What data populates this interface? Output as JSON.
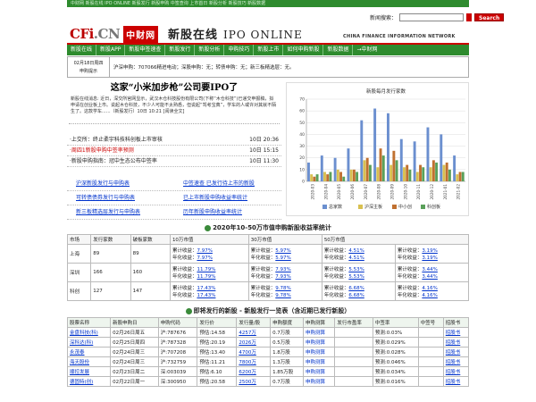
{
  "top_strip": "中财网 新股在线 IPO ONLINE 新股发行 新股申购 中签查询 上市首日 新股分析 新股技巧 新股数据",
  "search": {
    "label": "新闻搜索：",
    "placeholder": "",
    "button": "Search"
  },
  "logo": {
    "cfi": "CFi",
    "cn": ".CN",
    "zcw": "中财网"
  },
  "banner": {
    "title": "新股在线",
    "ipo": "IPO ONLINE",
    "en": "CHINA FINANCE INFORMATION NETWORK"
  },
  "nav": [
    "新股在线",
    "新股APP",
    "新股申签速查",
    "新股发行",
    "新股分析",
    "申购技巧",
    "新股上市",
    "如何申购新股",
    "新股数据",
    "→中财网"
  ],
  "notice": {
    "date": "02月18日周四",
    "label": "申购提示",
    "text_html": "沪深申购：707066精进电动；深股申购：无；转债申购：无；新三板精选层：无。"
  },
  "news": {
    "headline": "这家“小米加步枪”公司要IPO了",
    "para": "新股在线消息: 近日，深交所官网显示，武汉木仓科技股份有限公司(下称“木仓科技”)已递交申报稿，拟申请在创业板上市。说起木仓科技，不少人可能不太熟悉，但说起“驾考宝典”，学车的人或许对其就不陌生了。这款学车......（新股发行）10日 10:21 [阅读全文]",
    "items": [
      {
        "title": "·上交所：终止柔宇科技科创板上市审核",
        "time": "10日 20:36",
        "hl": false
      },
      {
        "title": "·周四1新股申购中签率预测",
        "time": "10日 15:15",
        "hl": true
      },
      {
        "title": "·新股申购指南：冠中生态公布中签率",
        "time": "10日 11:30",
        "hl": false
      }
    ]
  },
  "links": [
    [
      "沪深新股发行与申购表",
      "中签速查 已发行待上市的新股"
    ],
    [
      "可转债债券发行与申购表",
      "已上市新股申购收益率统计"
    ],
    [
      "新三板精选层发行与申购表",
      "历年新股申购收益率统计"
    ]
  ],
  "chart_data": {
    "type": "bar",
    "title": "新股每月发行家数",
    "categories": [
      "2020-03",
      "2020-04",
      "2020-05",
      "2020-06",
      "2020-07",
      "2020-08",
      "2020-09",
      "2020-10",
      "2020-11",
      "2020-12",
      "2021-01",
      "2021-02"
    ],
    "series": [
      {
        "name": "总家数",
        "color": "#6b8fcf",
        "values": [
          16,
          22,
          20,
          28,
          52,
          62,
          58,
          36,
          34,
          46,
          40,
          22
        ]
      },
      {
        "name": "沪深主板",
        "color": "#d8c050",
        "values": [
          6,
          8,
          10,
          10,
          18,
          12,
          14,
          12,
          8,
          12,
          14,
          6
        ]
      },
      {
        "name": "中小创",
        "color": "#c07030",
        "values": [
          4,
          6,
          8,
          10,
          20,
          28,
          26,
          14,
          14,
          18,
          16,
          8
        ]
      },
      {
        "name": "科创板",
        "color": "#5aa05a",
        "values": [
          6,
          8,
          4,
          8,
          14,
          22,
          18,
          10,
          12,
          16,
          10,
          8
        ]
      }
    ],
    "ylim": [
      0,
      70
    ],
    "yticks": [
      0,
      10,
      20,
      30,
      40,
      50,
      60,
      70
    ],
    "legend": "bottom"
  },
  "rate": {
    "title": "2020年10-50万市值申购新股收益率统计",
    "headers": [
      "市场",
      "发行家数",
      "破板家数",
      "10万市值",
      "30万市值",
      "50万市值"
    ],
    "rows": [
      {
        "market": "上海",
        "issued": "89",
        "broken": "89",
        "c10": [
          "累计收益：",
          "7.97%",
          "年化收益：",
          "7.97%"
        ],
        "c30": [
          "累计收益：",
          "5.97%",
          "年化收益：",
          "5.97%"
        ],
        "c50": [
          "累计收益：",
          "4.51%",
          "年化收益：",
          "4.51%"
        ],
        "c50b": [
          "累计收益：",
          "3.19%",
          "年化收益：",
          "3.19%"
        ]
      },
      {
        "market": "深圳",
        "issued": "166",
        "broken": "160",
        "c10": [
          "累计收益：",
          "11.79%",
          "年化收益：",
          "11.79%"
        ],
        "c30": [
          "累计收益：",
          "7.93%",
          "年化收益：",
          "7.93%"
        ],
        "c50": [
          "累计收益：",
          "5.53%",
          "年化收益：",
          "5.53%"
        ],
        "c50b": [
          "累计收益：",
          "3.44%",
          "年化收益：",
          "3.44%"
        ]
      },
      {
        "market": "科创",
        "issued": "127",
        "broken": "147",
        "c10": [
          "累计收益：",
          "17.43%",
          "年化收益：",
          "17.43%"
        ],
        "c30": [
          "累计收益：",
          "9.78%",
          "年化收益：",
          "9.78%"
        ],
        "c50": [
          "累计收益：",
          "6.68%",
          "年化收益：",
          "6.68%"
        ],
        "c50b": [
          "累计收益：",
          "4.16%",
          "年化收益：",
          "4.16%"
        ]
      }
    ]
  },
  "upcoming": {
    "title": "即将发行的新股 - 新股发行一览表（含近期已发行新股）",
    "headers": [
      "股票名称",
      "新股申购日",
      "申购代码",
      "发行价",
      "发行量/股",
      "申购额度",
      "申购测算",
      "发行市盈率",
      "中签率",
      "中签号",
      "招股书"
    ],
    "rows": [
      [
        "金盘科技(科)",
        "02月26日周五",
        "沪:787676",
        "预估:14.58",
        "4257万",
        "0.7万股",
        "申购测算",
        "",
        "预测:0.03%",
        "",
        "招股书"
      ],
      [
        "深科达(科)",
        "02月25日周四",
        "沪:787328",
        "预估:20.19",
        "2026万",
        "0.5万股",
        "申购测算",
        "",
        "预测:0.029%",
        "",
        "招股书"
      ],
      [
        "永茂泰",
        "02月24日周三",
        "沪:707208",
        "预估:13.40",
        "4700万",
        "1.8万股",
        "申购测算",
        "",
        "预测:0.028%",
        "",
        "招股书"
      ],
      [
        "海天股份",
        "02月24日周三",
        "沪:732759",
        "预估:11.21",
        "7800万",
        "1.3万股",
        "申购测算",
        "",
        "预测:0.046%",
        "",
        "招股书"
      ],
      [
        "顺控发展",
        "02月23日周二",
        "深:003039",
        "预估:6.10",
        "6200万",
        "1.85万股",
        "申购测算",
        "",
        "预测:0.034%",
        "",
        "招股书"
      ],
      [
        "德固特(创)",
        "02月22日周一",
        "深:300950",
        "预估:20.58",
        "2500万",
        "0.7万股",
        "申购测算",
        "",
        "预测:0.016%",
        "",
        "招股书"
      ]
    ]
  }
}
